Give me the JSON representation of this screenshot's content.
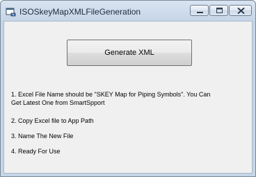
{
  "window": {
    "title": "ISOSkeyMapXMLFileGeneration",
    "controls": {
      "minimize": "minimize",
      "maximize": "maximize",
      "close": "close"
    }
  },
  "main": {
    "generate_button_label": "Generate XML",
    "instructions": {
      "step1_line1": "1. Excel File Name should be \"SKEY Map for Piping Symbols\".     You Can",
      "step1_line2": "Get Latest One from SmartSpport",
      "step2": "2. Copy Excel file to App Path",
      "step3": "3. Name The New File",
      "step4": "4. Ready For Use"
    }
  },
  "colors": {
    "title_text": "#1e2a38",
    "client_bg": "#f0f0f0",
    "frame": "#c5d5e7"
  },
  "icons": [
    "app-icon",
    "minimize-icon",
    "maximize-icon",
    "close-icon"
  ]
}
